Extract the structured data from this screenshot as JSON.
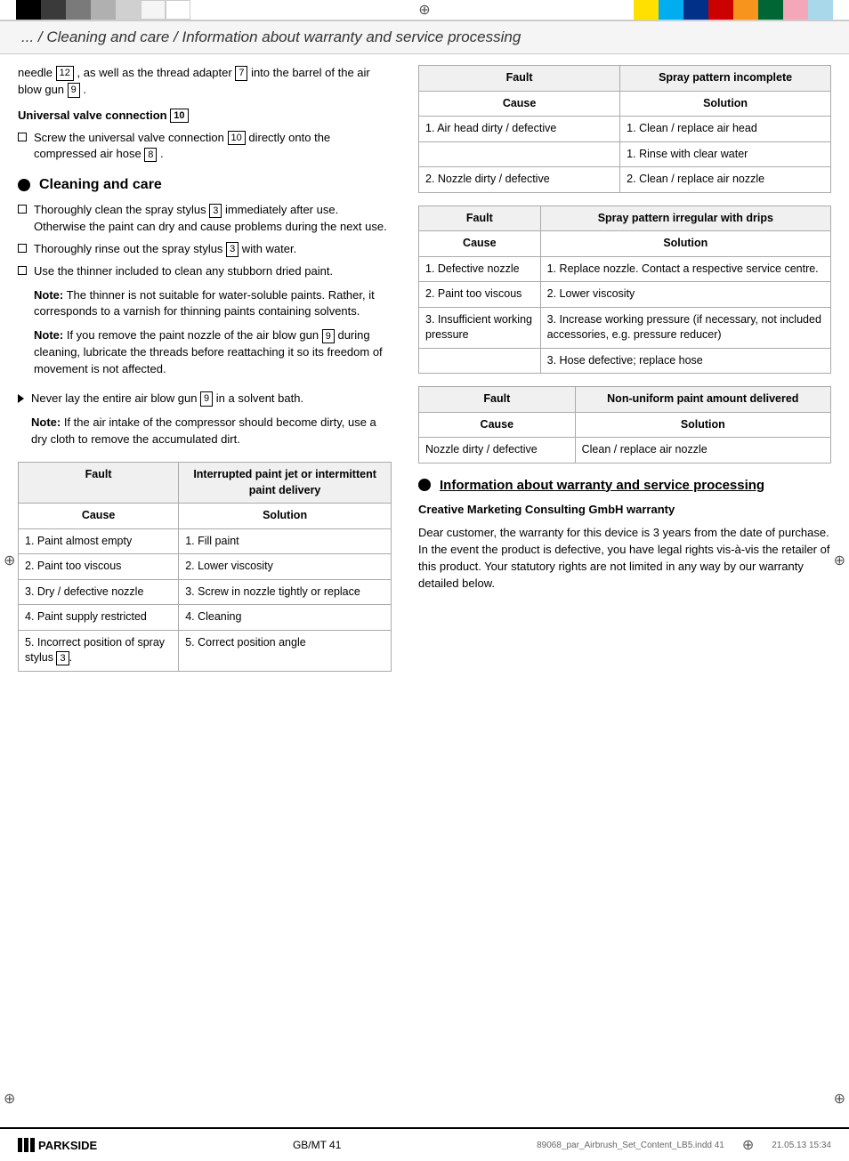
{
  "page": {
    "title": "... / Cleaning and care / Information about warranty and service processing",
    "page_number": "GB/MT   41",
    "file_info": "89068_par_Airbrush_Set_Content_LB5.indd   41",
    "date_info": "21.05.13   15:34"
  },
  "color_bar": {
    "left_colors": [
      "black",
      "dark",
      "mid",
      "lgray",
      "llgray",
      "white",
      "wwhite"
    ],
    "right_colors": [
      "yellow",
      "cyan",
      "blue",
      "red",
      "orange",
      "green",
      "pink",
      "ltblue"
    ]
  },
  "left_column": {
    "intro_text": "needle",
    "needle_num": "12",
    "intro_text2": ", as well as the thread adapter",
    "adapter_num": "7",
    "intro_text3": "into the barrel of the air blow gun",
    "gun_num": "9",
    "intro_text4": ".",
    "universal_valve": {
      "heading": "Universal valve connection",
      "num": "10",
      "bullet": "Screw the universal valve connection",
      "connection_num": "10",
      "text": "directly onto the compressed air hose",
      "hose_num": "8",
      "end": "."
    },
    "cleaning_section": {
      "title": "Cleaning and care",
      "bullets": [
        {
          "type": "square",
          "text": "Thoroughly clean the spray stylus",
          "num": "3",
          "text2": "immediately after use. Otherwise the paint can dry and cause problems during the next use."
        },
        {
          "type": "square",
          "text": "Thoroughly rinse out the spray stylus",
          "num": "3",
          "text2": "with water."
        },
        {
          "type": "square",
          "text": "Use the thinner included to clean any stubborn dried paint.",
          "note1_label": "Note:",
          "note1": "The thinner is not suitable for water-soluble paints. Rather, it corresponds to a varnish for thinning paints containing solvents.",
          "note2_label": "Note:",
          "note2": "If you remove the paint nozzle of the air blow gun",
          "note2_num": "9",
          "note2_cont": "during cleaning, lubricate the threads before reattaching it so its freedom of movement is not affected."
        },
        {
          "type": "triangle",
          "text": "Never lay the entire air blow gun",
          "num": "9",
          "text2": "in a solvent bath.",
          "note_label": "Note:",
          "note": "If the air intake of the compressor should become dirty, use a dry cloth to remove the accumulated dirt."
        }
      ]
    }
  },
  "fault_table_1": {
    "title": "Fault",
    "col2_title": "Interrupted paint jet or intermittent paint delivery",
    "cause_label": "Cause",
    "solution_label": "Solution",
    "rows": [
      {
        "cause": "1. Paint almost empty",
        "solution": "1. Fill paint"
      },
      {
        "cause": "2. Paint too viscous",
        "solution": "2. Lower viscosity"
      },
      {
        "cause": "3. Dry / defective nozzle",
        "solution": "3. Screw in nozzle tightly or replace"
      },
      {
        "cause": "4. Paint supply restricted",
        "solution": "4. Cleaning"
      },
      {
        "cause": "5. Incorrect position of spray stylus",
        "cause_num": "3",
        "solution": "5. Correct position angle"
      }
    ]
  },
  "fault_table_2": {
    "title": "Fault",
    "col2_title": "Spray pattern incomplete",
    "cause_label": "Cause",
    "solution_label": "Solution",
    "rows": [
      {
        "cause": "1. Air head dirty / defective",
        "solution": "1. Clean / replace air head"
      },
      {
        "cause": "",
        "solution": "1. Rinse with clear water"
      },
      {
        "cause": "2. Nozzle dirty / defective",
        "solution": "2. Clean / replace air nozzle"
      }
    ]
  },
  "fault_table_3": {
    "title": "Fault",
    "col2_title": "Spray pattern irregular with drips",
    "cause_label": "Cause",
    "solution_label": "Solution",
    "rows": [
      {
        "cause": "1. Defective nozzle",
        "solution": "1. Replace nozzle. Contact a respective service centre."
      },
      {
        "cause": "2. Paint too viscous",
        "solution": "2. Lower viscosity"
      },
      {
        "cause": "3. Insufficient working pressure",
        "solution": "3. Increase working pressure (if necessary, not included accessories, e.g. pressure reducer)"
      },
      {
        "cause": "",
        "solution": "3. Hose defective; replace hose"
      }
    ]
  },
  "fault_table_4": {
    "title": "Fault",
    "col2_title": "Non-uniform paint amount delivered",
    "cause_label": "Cause",
    "solution_label": "Solution",
    "rows": [
      {
        "cause": "Nozzle dirty / defective",
        "solution": "Clean / replace air nozzle"
      }
    ]
  },
  "warranty_section": {
    "title": "Information about warranty and service processing",
    "subheading": "Creative Marketing Consulting GmbH warranty",
    "text": "Dear customer, the warranty for this device is 3 years from the date of purchase. In the event the product is defective, you have legal rights vis-à-vis the retailer of this product. Your statutory rights are not limited in any way by our warranty detailed below."
  },
  "parkside": {
    "logo_label": "/// PARKSIDE"
  }
}
